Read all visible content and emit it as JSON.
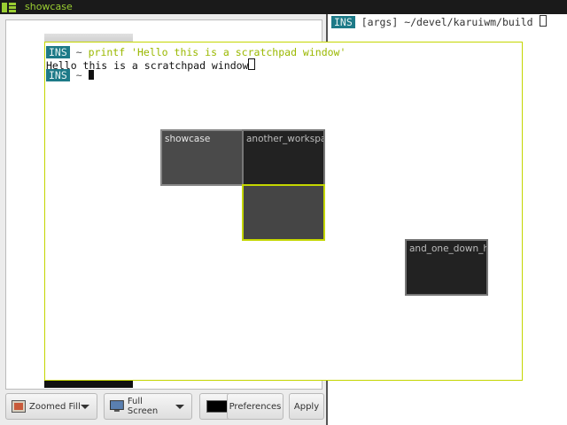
{
  "topbar": {
    "title": "showcase",
    "layout_icon": "grid-layout-icon"
  },
  "left_window": {
    "buttons": {
      "zoom_label": "Zoomed Fill",
      "fullscreen_label": "Full Screen",
      "prefs_label": "Preferences",
      "apply_label": "Apply"
    },
    "color_swatch": "#000000"
  },
  "right_terminal": {
    "mode": "INS",
    "context": "[args]",
    "path": "~/devel/karuiwm/build"
  },
  "scratchpad": {
    "mode": "INS",
    "prompt": "~",
    "command": "printf 'Hello this is a scratchpad window'",
    "output": "Hello this is a scratchpad window"
  },
  "workspaces": {
    "showcase": "showcase",
    "another": "another_workspace",
    "down": "and_one_down_here"
  },
  "colors": {
    "accent": "#c4d600",
    "mode_badge": "#1d7a88"
  }
}
